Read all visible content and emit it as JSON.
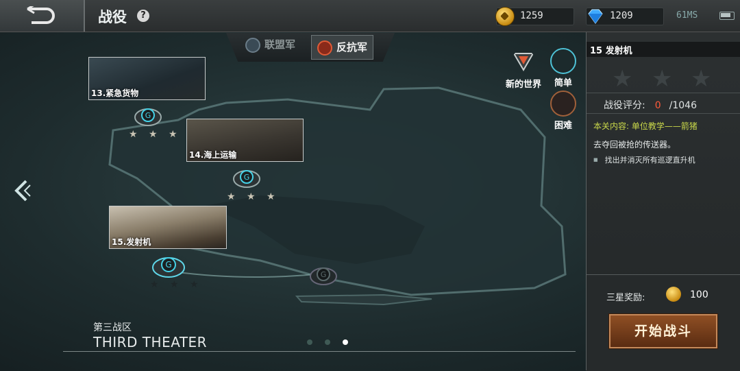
{
  "header": {
    "title": "战役",
    "help_symbol": "?"
  },
  "currency": {
    "gold": "1259",
    "diamonds": "1209",
    "ping": "61MS"
  },
  "tabs": [
    {
      "label": "联盟军",
      "active": false
    },
    {
      "label": "反抗军",
      "active": true
    }
  ],
  "modes": [
    {
      "label": "新的世界",
      "icon": "world-emblem-icon"
    },
    {
      "label": "简单",
      "icon": "easy-bullet-icon"
    },
    {
      "label": "困难",
      "icon": "hard-shell-icon"
    }
  ],
  "missions": [
    {
      "label": "13.紧急货物",
      "stars": "★ ★ ★"
    },
    {
      "label": "14.海上运输",
      "stars": "★ ★ ★"
    },
    {
      "label": "15.发射机",
      "stars": "★ ★ ★"
    }
  ],
  "theater": {
    "cn": "第三战区",
    "en": "THIRD THEATER"
  },
  "pagination": {
    "count": 3,
    "active": 2
  },
  "panel": {
    "mission_title": "15  发射机",
    "rating_label": "战役评分:",
    "rating_score": "0",
    "rating_total": "/1046",
    "goal_label": "本关内容: 单位教学——箭猪",
    "goal_desc": "去夺回被抢的传送器。",
    "goal_bullet": "找出并消灭所有巡逻直升机",
    "reward_label": "三星奖励:",
    "reward_value": "100",
    "start_button": "开始战斗"
  },
  "colors": {
    "accent_score": "#ff5a3a",
    "goal_label": "#c9d84a",
    "button": "#7a4220"
  }
}
